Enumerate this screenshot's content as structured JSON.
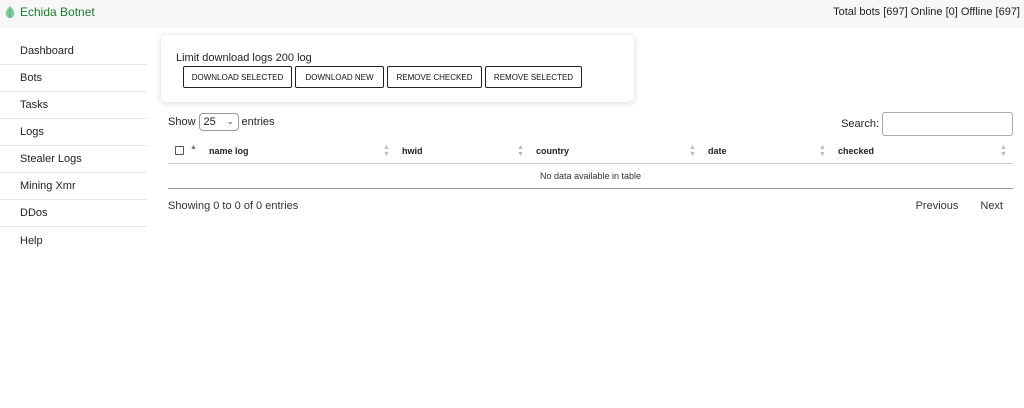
{
  "app": {
    "title": "Echida Botnet",
    "stats_text": "Total bots [697] Online [0] Offline [697]",
    "logo_icon": "leaf-icon",
    "brand_color": "#1b7a2f"
  },
  "sidebar": {
    "items": [
      {
        "label": "Dashboard"
      },
      {
        "label": "Bots"
      },
      {
        "label": "Tasks"
      },
      {
        "label": "Logs"
      },
      {
        "label": "Stealer Logs"
      },
      {
        "label": "Mining Xmr"
      },
      {
        "label": "DDos"
      },
      {
        "label": "Help"
      }
    ]
  },
  "panel": {
    "limit_text": "Limit download logs 200 log",
    "buttons": [
      {
        "label": "DOWNLOAD SELECTED"
      },
      {
        "label": "DOWNLOAD NEW"
      },
      {
        "label": "REMOVE CHECKED"
      },
      {
        "label": "REMOVE SELECTED"
      }
    ]
  },
  "table_controls": {
    "show_label": "Show",
    "entries_value": "25",
    "entries_label": "entries",
    "search_label": "Search:",
    "search_value": ""
  },
  "table": {
    "columns": [
      {
        "label": "name log"
      },
      {
        "label": "hwid"
      },
      {
        "label": "country"
      },
      {
        "label": "date"
      },
      {
        "label": "checked"
      }
    ],
    "empty_text": "No data available in table"
  },
  "footer": {
    "info": "Showing 0 to 0 of 0 entries",
    "previous": "Previous",
    "next": "Next"
  }
}
